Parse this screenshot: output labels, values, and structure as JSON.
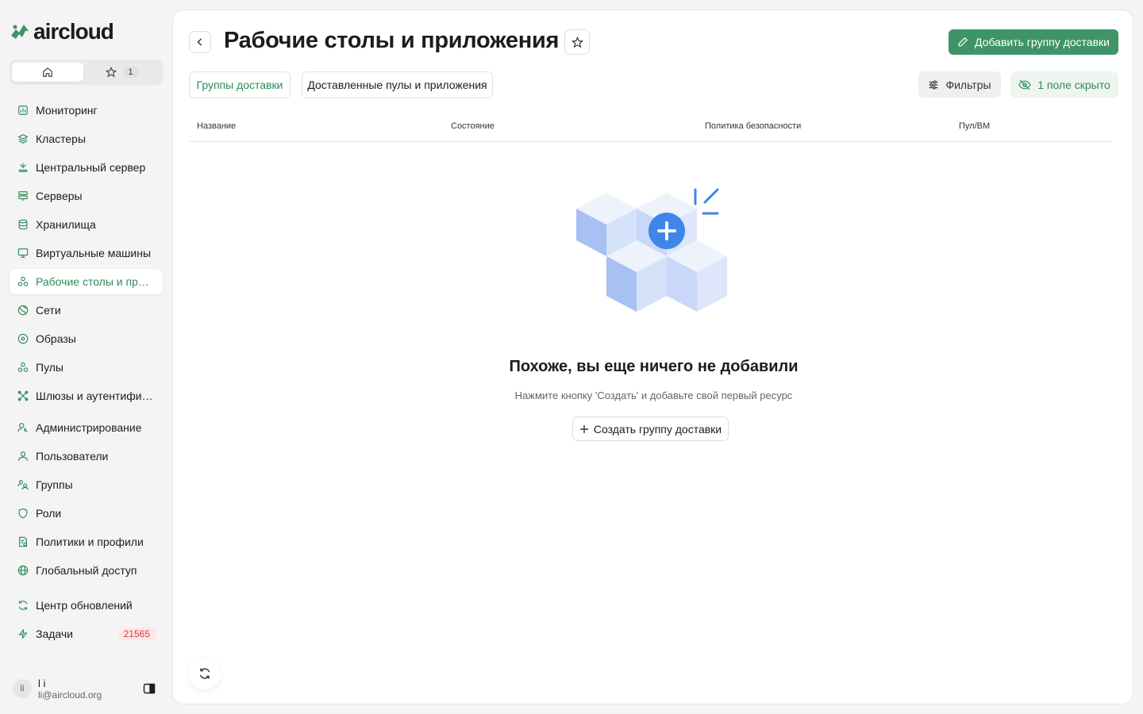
{
  "brand": {
    "name": "aircloud",
    "accent": "#3f9467"
  },
  "view_switch": {
    "favorites_count": "1"
  },
  "sidebar": {
    "items": [
      {
        "label": "Мониторинг",
        "icon": "chart-icon"
      },
      {
        "label": "Кластеры",
        "icon": "layers-icon"
      },
      {
        "label": "Центральный сервер",
        "icon": "central-server-icon"
      },
      {
        "label": "Серверы",
        "icon": "server-icon"
      },
      {
        "label": "Хранилища",
        "icon": "database-icon"
      },
      {
        "label": "Виртуальные машины",
        "icon": "monitor-icon"
      },
      {
        "label": "Рабочие столы и приложения",
        "icon": "apps-icon",
        "active": true
      },
      {
        "label": "Сети",
        "icon": "network-icon"
      },
      {
        "label": "Образы",
        "icon": "disc-icon"
      },
      {
        "label": "Пулы",
        "icon": "pools-icon"
      },
      {
        "label": "Шлюзы и аутентификация",
        "icon": "gateway-icon"
      },
      {
        "label": "Администрирование",
        "icon": "admin-icon"
      },
      {
        "label": "Пользователи",
        "icon": "user-icon"
      },
      {
        "label": "Группы",
        "icon": "group-icon"
      },
      {
        "label": "Роли",
        "icon": "shield-icon"
      },
      {
        "label": "Политики и профили",
        "icon": "policy-icon"
      },
      {
        "label": "Глобальный доступ",
        "icon": "globe-icon"
      },
      {
        "label": "Центр обновлений",
        "icon": "refresh-icon"
      },
      {
        "label": "Задачи",
        "icon": "bolt-icon",
        "badge": "21565"
      }
    ]
  },
  "user": {
    "initials": "li",
    "name": "l i",
    "email": "li@aircloud.org"
  },
  "header": {
    "title": "Рабочие столы и приложения",
    "add_button": "Добавить группу доставки"
  },
  "tabs": [
    "Группы доставки",
    "Доставленные пулы и приложения"
  ],
  "toolbar": {
    "filters": "Фильтры",
    "hidden_fields": "1 поле скрыто"
  },
  "table": {
    "columns": [
      "Название",
      "Состояние",
      "Политика безопасности",
      "Пул/ВМ"
    ]
  },
  "empty_state": {
    "title": "Похоже, вы еще ничего не добавили",
    "subtitle": "Нажмите кнопку 'Создать' и добавьте свой первый ресурс",
    "create_button": "Создать группу доставки"
  }
}
